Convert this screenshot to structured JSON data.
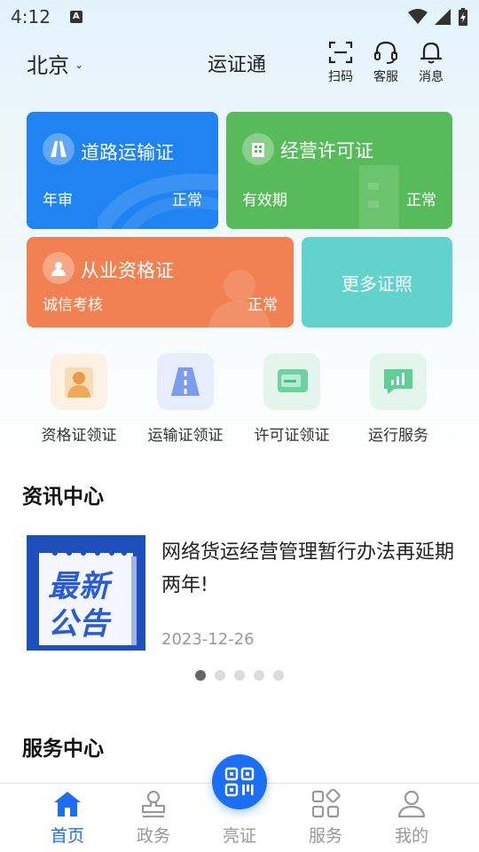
{
  "status_bar": {
    "time": "4:12",
    "notif_icon": "A"
  },
  "header": {
    "city": "北京",
    "title": "运证通",
    "buttons": [
      {
        "label": "扫码",
        "icon": "scan-icon"
      },
      {
        "label": "客服",
        "icon": "headset-icon"
      },
      {
        "label": "消息",
        "icon": "bell-icon"
      }
    ]
  },
  "cards": {
    "road": {
      "title": "道路运输证",
      "sub": "年审",
      "status": "正常",
      "color": "#1f83f2"
    },
    "business": {
      "title": "经营许可证",
      "sub": "有效期",
      "status": "正常",
      "color": "#58bb5b"
    },
    "professional": {
      "title": "从业资格证",
      "sub": "诚信考核",
      "status": "正常",
      "color": "#f18152"
    },
    "more": {
      "label": "更多证照",
      "color": "#62d3cc"
    }
  },
  "quick_actions": [
    {
      "label": "资格证领证",
      "icon": "person-card-icon"
    },
    {
      "label": "运输证领证",
      "icon": "road-icon"
    },
    {
      "label": "许可证领证",
      "icon": "license-card-icon"
    },
    {
      "label": "运行服务",
      "icon": "chart-message-icon"
    }
  ],
  "news_section": {
    "title": "资讯中心",
    "thumb_text": [
      "最新",
      "公告"
    ],
    "item": {
      "title": "网络货运经营管理暂行办法再延期两年!",
      "date": "2023-12-26"
    },
    "dots_total": 5,
    "dots_active": 1
  },
  "service_section": {
    "title": "服务中心"
  },
  "tabbar": {
    "tabs": [
      {
        "label": "首页",
        "icon": "home-icon",
        "active": true
      },
      {
        "label": "政务",
        "icon": "stamp-icon",
        "active": false
      },
      {
        "label": "亮证",
        "icon": "qr-code-icon",
        "active": false
      },
      {
        "label": "服务",
        "icon": "grid-icon",
        "active": false
      },
      {
        "label": "我的",
        "icon": "user-icon",
        "active": false
      }
    ]
  },
  "colors": {
    "accent": "#1c6ff5",
    "inactive": "#999999"
  }
}
